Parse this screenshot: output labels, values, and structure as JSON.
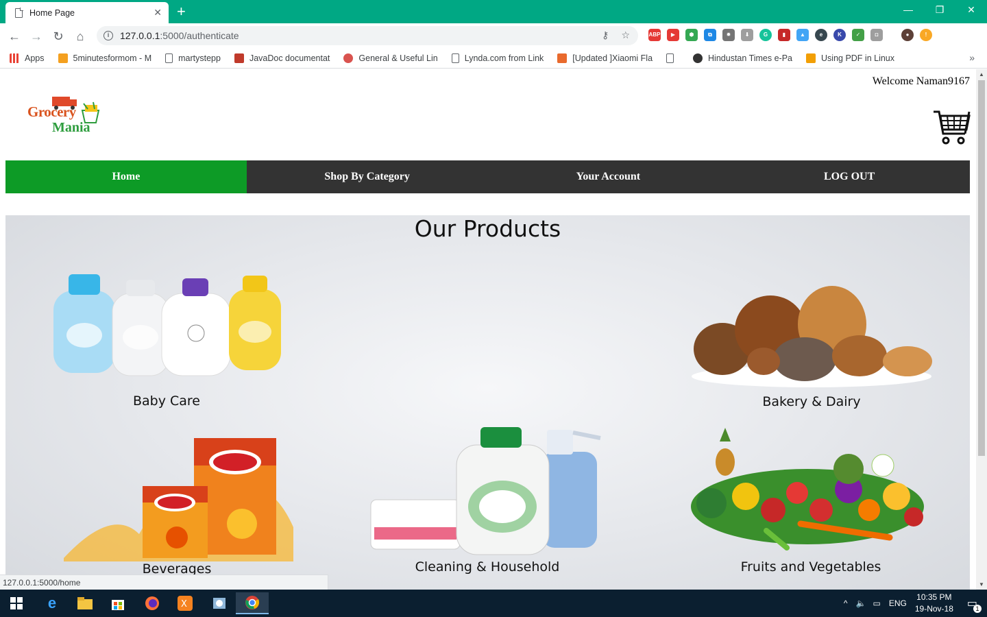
{
  "browser": {
    "tab_title": "Home Page",
    "url_host": "127.0.0.1",
    "url_path": ":5000/authenticate",
    "bookmarks": [
      {
        "label": "Apps",
        "color": "#e94235"
      },
      {
        "label": "5minutesformom - M",
        "color": "#f4a020"
      },
      {
        "label": "martystepp",
        "color": "#5f6368"
      },
      {
        "label": "JavaDoc documentat",
        "color": "#c03a2b"
      },
      {
        "label": "General & Useful Lin",
        "color": "#d9534f"
      },
      {
        "label": "Lynda.com from Link",
        "color": "#5f6368"
      },
      {
        "label": "[Updated ]Xiaomi Fla",
        "color": "#e96a2d"
      },
      {
        "label": "",
        "color": "#5f6368"
      },
      {
        "label": "Hindustan Times e-Pa",
        "color": "#333333"
      },
      {
        "label": "Using PDF in Linux",
        "color": "#f29f05"
      }
    ],
    "status_url": "127.0.0.1:5000/home"
  },
  "page": {
    "welcome": "Welcome Naman9167",
    "logo_line1": "Grocery",
    "logo_line2": "Mania",
    "nav": [
      {
        "label": "Home",
        "active": true
      },
      {
        "label": "Shop By Category",
        "active": false
      },
      {
        "label": "Your Account",
        "active": false
      },
      {
        "label": "LOG OUT",
        "active": false
      }
    ],
    "products_title": "Our Products",
    "products": [
      {
        "label": "Baby Care",
        "icon": "baby-care-image"
      },
      {
        "label": "Bakery & Dairy",
        "icon": "bakery-image"
      },
      {
        "label": "Beverages",
        "icon": "beverages-image"
      },
      {
        "label": "Cleaning & Household",
        "icon": "cleaning-image"
      },
      {
        "label": "Fruits and Vegetables",
        "icon": "vegetables-image"
      }
    ]
  },
  "taskbar": {
    "language": "ENG",
    "time": "10:35 PM",
    "date": "19-Nov-18",
    "notification_count": "1"
  },
  "colors": {
    "tab_bar": "#00a884",
    "nav_active": "#0d9b26",
    "nav_bg": "#333333"
  }
}
